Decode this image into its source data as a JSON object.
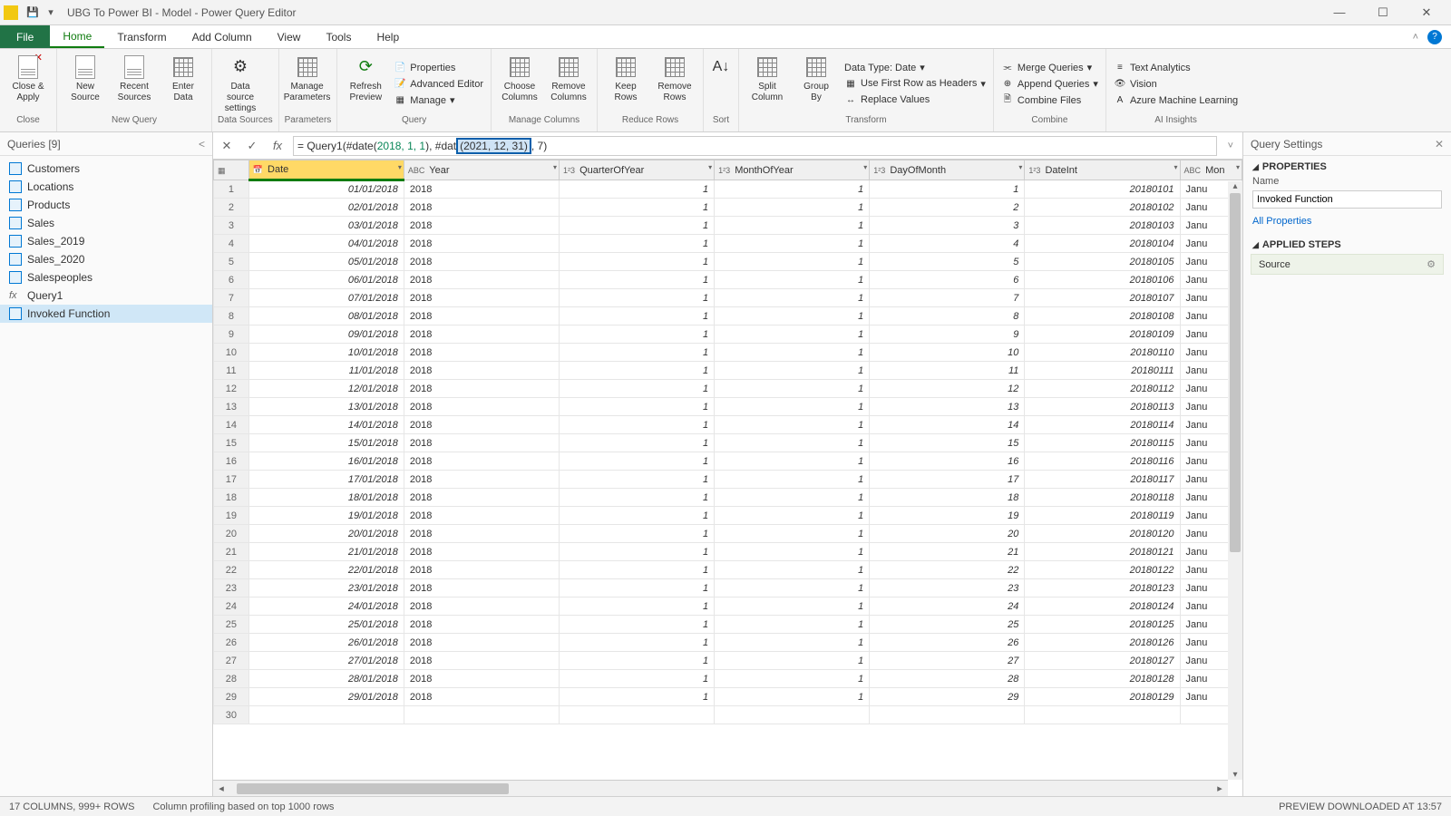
{
  "window": {
    "title": "UBG To Power BI - Model - Power Query Editor"
  },
  "tabs": {
    "file": "File",
    "home": "Home",
    "transform": "Transform",
    "addcolumn": "Add Column",
    "view": "View",
    "tools": "Tools",
    "help": "Help"
  },
  "ribbon": {
    "close": {
      "label": "Close &\nApply",
      "group": "Close"
    },
    "newquery": {
      "new": "New\nSource",
      "recent": "Recent\nSources",
      "enter": "Enter\nData",
      "group": "New Query"
    },
    "datasources": {
      "settings": "Data source\nsettings",
      "group": "Data Sources"
    },
    "parameters": {
      "manage": "Manage\nParameters",
      "group": "Parameters"
    },
    "query": {
      "refresh": "Refresh\nPreview",
      "properties": "Properties",
      "advanced": "Advanced Editor",
      "manage": "Manage",
      "group": "Query"
    },
    "managecols": {
      "choose": "Choose\nColumns",
      "remove": "Remove\nColumns",
      "group": "Manage Columns"
    },
    "reducerows": {
      "keep": "Keep\nRows",
      "remove": "Remove\nRows",
      "group": "Reduce Rows"
    },
    "sort": {
      "group": "Sort"
    },
    "transform": {
      "split": "Split\nColumn",
      "groupby": "Group\nBy",
      "datatype": "Data Type: Date",
      "firstrow": "Use First Row as Headers",
      "replace": "Replace Values",
      "group": "Transform"
    },
    "combine": {
      "merge": "Merge Queries",
      "append": "Append Queries",
      "combinefiles": "Combine Files",
      "group": "Combine"
    },
    "ai": {
      "text": "Text Analytics",
      "vision": "Vision",
      "ml": "Azure Machine Learning",
      "group": "AI Insights"
    }
  },
  "queries": {
    "header": "Queries [9]",
    "items": [
      "Customers",
      "Locations",
      "Products",
      "Sales",
      "Sales_2019",
      "Sales_2020",
      "Salespeoples",
      "Query1",
      "Invoked Function"
    ]
  },
  "formula": {
    "prefix": "= Query1(#date(",
    "args1": "2018, 1, 1",
    "mid": "), #dat",
    "highlight": "(2021, 12, 31)",
    "suffix": ", 7)"
  },
  "columns": [
    "Date",
    "Year",
    "QuarterOfYear",
    "MonthOfYear",
    "DayOfMonth",
    "DateInt",
    "Mon"
  ],
  "rows": [
    {
      "n": 1,
      "date": "01/01/2018",
      "year": "2018",
      "q": "1",
      "m": "1",
      "d": "1",
      "di": "20180101",
      "mon": "Janu"
    },
    {
      "n": 2,
      "date": "02/01/2018",
      "year": "2018",
      "q": "1",
      "m": "1",
      "d": "2",
      "di": "20180102",
      "mon": "Janu"
    },
    {
      "n": 3,
      "date": "03/01/2018",
      "year": "2018",
      "q": "1",
      "m": "1",
      "d": "3",
      "di": "20180103",
      "mon": "Janu"
    },
    {
      "n": 4,
      "date": "04/01/2018",
      "year": "2018",
      "q": "1",
      "m": "1",
      "d": "4",
      "di": "20180104",
      "mon": "Janu"
    },
    {
      "n": 5,
      "date": "05/01/2018",
      "year": "2018",
      "q": "1",
      "m": "1",
      "d": "5",
      "di": "20180105",
      "mon": "Janu"
    },
    {
      "n": 6,
      "date": "06/01/2018",
      "year": "2018",
      "q": "1",
      "m": "1",
      "d": "6",
      "di": "20180106",
      "mon": "Janu"
    },
    {
      "n": 7,
      "date": "07/01/2018",
      "year": "2018",
      "q": "1",
      "m": "1",
      "d": "7",
      "di": "20180107",
      "mon": "Janu"
    },
    {
      "n": 8,
      "date": "08/01/2018",
      "year": "2018",
      "q": "1",
      "m": "1",
      "d": "8",
      "di": "20180108",
      "mon": "Janu"
    },
    {
      "n": 9,
      "date": "09/01/2018",
      "year": "2018",
      "q": "1",
      "m": "1",
      "d": "9",
      "di": "20180109",
      "mon": "Janu"
    },
    {
      "n": 10,
      "date": "10/01/2018",
      "year": "2018",
      "q": "1",
      "m": "1",
      "d": "10",
      "di": "20180110",
      "mon": "Janu"
    },
    {
      "n": 11,
      "date": "11/01/2018",
      "year": "2018",
      "q": "1",
      "m": "1",
      "d": "11",
      "di": "20180111",
      "mon": "Janu"
    },
    {
      "n": 12,
      "date": "12/01/2018",
      "year": "2018",
      "q": "1",
      "m": "1",
      "d": "12",
      "di": "20180112",
      "mon": "Janu"
    },
    {
      "n": 13,
      "date": "13/01/2018",
      "year": "2018",
      "q": "1",
      "m": "1",
      "d": "13",
      "di": "20180113",
      "mon": "Janu"
    },
    {
      "n": 14,
      "date": "14/01/2018",
      "year": "2018",
      "q": "1",
      "m": "1",
      "d": "14",
      "di": "20180114",
      "mon": "Janu"
    },
    {
      "n": 15,
      "date": "15/01/2018",
      "year": "2018",
      "q": "1",
      "m": "1",
      "d": "15",
      "di": "20180115",
      "mon": "Janu"
    },
    {
      "n": 16,
      "date": "16/01/2018",
      "year": "2018",
      "q": "1",
      "m": "1",
      "d": "16",
      "di": "20180116",
      "mon": "Janu"
    },
    {
      "n": 17,
      "date": "17/01/2018",
      "year": "2018",
      "q": "1",
      "m": "1",
      "d": "17",
      "di": "20180117",
      "mon": "Janu"
    },
    {
      "n": 18,
      "date": "18/01/2018",
      "year": "2018",
      "q": "1",
      "m": "1",
      "d": "18",
      "di": "20180118",
      "mon": "Janu"
    },
    {
      "n": 19,
      "date": "19/01/2018",
      "year": "2018",
      "q": "1",
      "m": "1",
      "d": "19",
      "di": "20180119",
      "mon": "Janu"
    },
    {
      "n": 20,
      "date": "20/01/2018",
      "year": "2018",
      "q": "1",
      "m": "1",
      "d": "20",
      "di": "20180120",
      "mon": "Janu"
    },
    {
      "n": 21,
      "date": "21/01/2018",
      "year": "2018",
      "q": "1",
      "m": "1",
      "d": "21",
      "di": "20180121",
      "mon": "Janu"
    },
    {
      "n": 22,
      "date": "22/01/2018",
      "year": "2018",
      "q": "1",
      "m": "1",
      "d": "22",
      "di": "20180122",
      "mon": "Janu"
    },
    {
      "n": 23,
      "date": "23/01/2018",
      "year": "2018",
      "q": "1",
      "m": "1",
      "d": "23",
      "di": "20180123",
      "mon": "Janu"
    },
    {
      "n": 24,
      "date": "24/01/2018",
      "year": "2018",
      "q": "1",
      "m": "1",
      "d": "24",
      "di": "20180124",
      "mon": "Janu"
    },
    {
      "n": 25,
      "date": "25/01/2018",
      "year": "2018",
      "q": "1",
      "m": "1",
      "d": "25",
      "di": "20180125",
      "mon": "Janu"
    },
    {
      "n": 26,
      "date": "26/01/2018",
      "year": "2018",
      "q": "1",
      "m": "1",
      "d": "26",
      "di": "20180126",
      "mon": "Janu"
    },
    {
      "n": 27,
      "date": "27/01/2018",
      "year": "2018",
      "q": "1",
      "m": "1",
      "d": "27",
      "di": "20180127",
      "mon": "Janu"
    },
    {
      "n": 28,
      "date": "28/01/2018",
      "year": "2018",
      "q": "1",
      "m": "1",
      "d": "28",
      "di": "20180128",
      "mon": "Janu"
    },
    {
      "n": 29,
      "date": "29/01/2018",
      "year": "2018",
      "q": "1",
      "m": "1",
      "d": "29",
      "di": "20180129",
      "mon": "Janu"
    },
    {
      "n": 30,
      "date": "",
      "year": "",
      "q": "",
      "m": "",
      "d": "",
      "di": "",
      "mon": ""
    }
  ],
  "settings": {
    "header": "Query Settings",
    "properties": "PROPERTIES",
    "name_label": "Name",
    "name_value": "Invoked Function",
    "allprops": "All Properties",
    "steps_header": "APPLIED STEPS",
    "step1": "Source"
  },
  "status": {
    "left1": "17 COLUMNS, 999+ ROWS",
    "left2": "Column profiling based on top 1000 rows",
    "right": "PREVIEW DOWNLOADED AT 13:57"
  }
}
